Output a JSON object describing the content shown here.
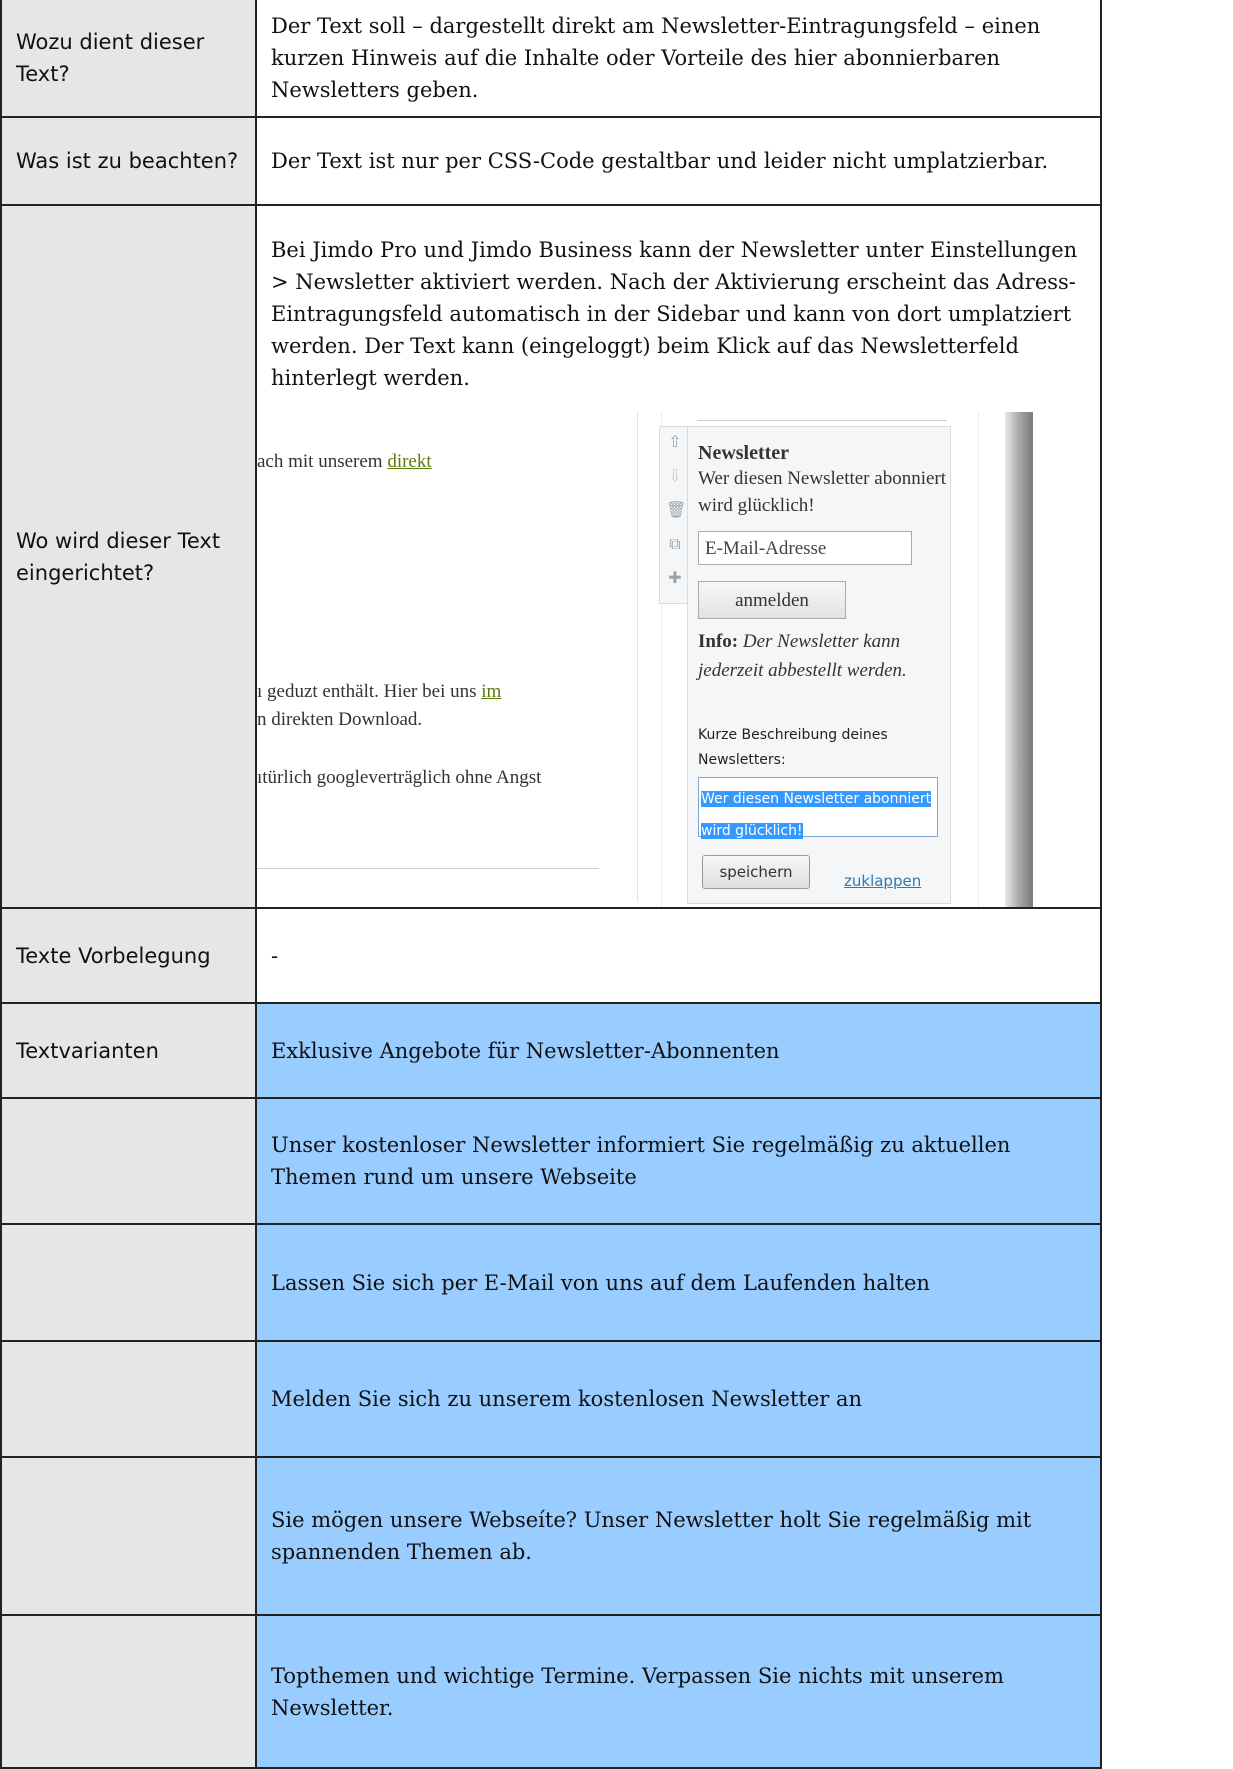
{
  "rows": [
    {
      "label": "Wozu dient dieser Text?",
      "value": "Der Text soll – dargestellt direkt am Newsletter-Eintragungsfeld – einen kurzen Hinweis auf die Inhalte oder Vorteile des hier abonnierbaren Newsletters geben."
    },
    {
      "label": "Was ist zu beachten?",
      "value": "Der Text ist nur per CSS-Code gestaltbar und leider nicht umplatzierbar."
    },
    {
      "label": "Wo wird dieser Text eingerichtet?",
      "value": "Bei Jimdo Pro und Jimdo Business kann der Newsletter unter Einstellungen > Newsletter aktiviert werden. Nach der Aktivierung erscheint das Adress-Eintragungsfeld automatisch in der Sidebar und kann von dort umplatziert werden. Der Text kann (eingeloggt) beim Klick auf das Newsletterfeld hinterlegt werden."
    },
    {
      "label": "Texte Vorbelegung",
      "value": "-"
    },
    {
      "label": "Textvarianten",
      "value": "Exklusive Angebote für Newsletter-Abonnenten"
    },
    {
      "label": "",
      "value": "Unser kostenloser Newsletter informiert Sie regelmäßig zu aktuellen Themen rund um unsere Webseite"
    },
    {
      "label": "",
      "value": "Lassen Sie sich per E-Mail von uns auf dem Laufenden halten"
    },
    {
      "label": "",
      "value": "Melden Sie sich zu unserem kostenlosen Newsletter an"
    },
    {
      "label": "",
      "value": "Sie mögen unsere Webseíte? Unser Newsletter holt Sie regelmäßig mit spannenden Themen ab."
    },
    {
      "label": "",
      "value": "Topthemen und wichtige Termine. Verpassen Sie nichts mit unserem Newsletter."
    }
  ],
  "screenshot": {
    "left_page": {
      "line1_prefix": "ach mit unserem ",
      "line1_link": "direkt",
      "line2_prefix": "ı geduzt enthält. Hier bei uns ",
      "line2_link": "im",
      "line3": "n direkten Download.",
      "line4": "ıtürlich googleverträglich ohne Angst"
    },
    "widget": {
      "title": "Newsletter",
      "description": "Wer diesen Newsletter abonniert wird glücklich!",
      "email_placeholder": "E-Mail-Adresse",
      "subscribe_button": "anmelden",
      "info_label": "Info:",
      "info_text": "Der Newsletter kann jederzeit abbestellt werden.",
      "short_description_label": "Kurze Beschreibung deines Newsletters:",
      "textarea_value": "Wer diesen Newsletter abonniert wird glücklich!",
      "save_button": "speichern",
      "collapse_link": "zuklappen"
    },
    "toolbar_icons": [
      "arrow-up-icon",
      "arrow-down-icon",
      "trash-icon",
      "copy-icon",
      "add-icon"
    ]
  }
}
